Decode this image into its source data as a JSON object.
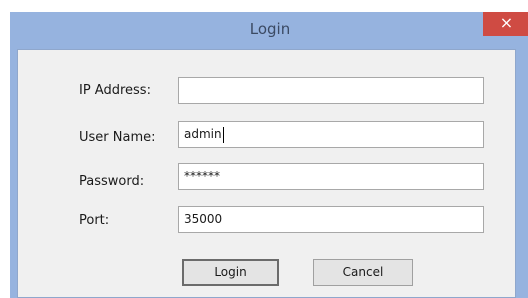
{
  "window": {
    "title": "Login",
    "close_glyph": "×"
  },
  "form": {
    "ip_label": "IP Address:",
    "ip_value": "",
    "user_label": "User Name:",
    "user_value": "admin",
    "password_label": "Password:",
    "password_value": "******",
    "port_label": "Port:",
    "port_value": "35000"
  },
  "buttons": {
    "login": "Login",
    "cancel": "Cancel"
  },
  "colors": {
    "titlebar": "#96b3df",
    "close_button": "#cf4b43",
    "client_background": "#f0f0f0"
  }
}
